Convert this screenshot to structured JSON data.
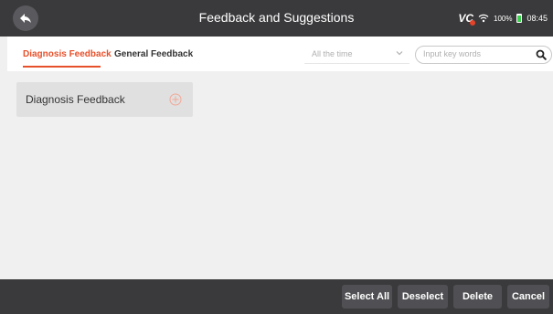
{
  "header": {
    "title": "Feedback and Suggestions",
    "back_icon": "back-arrow-icon",
    "status": {
      "vci_label": "VC",
      "wifi_icon": "wifi-icon",
      "battery_pct": "100%",
      "battery_icon": "battery-icon",
      "time": "08:45"
    }
  },
  "tabs": [
    {
      "label": "Diagnosis Feedback",
      "active": true
    },
    {
      "label": "General Feedback",
      "active": false
    }
  ],
  "filter": {
    "time_value": "All the time",
    "search_placeholder": "Input key words"
  },
  "list": [
    {
      "label": "Diagnosis Feedback",
      "icon": "add-circle-icon"
    }
  ],
  "footer": {
    "select_all": "Select All",
    "deselect": "Deselect",
    "delete": "Delete",
    "cancel": "Cancel"
  },
  "colors": {
    "accent": "#e8502b",
    "bar": "#3a3a3c",
    "button": "#505054"
  }
}
